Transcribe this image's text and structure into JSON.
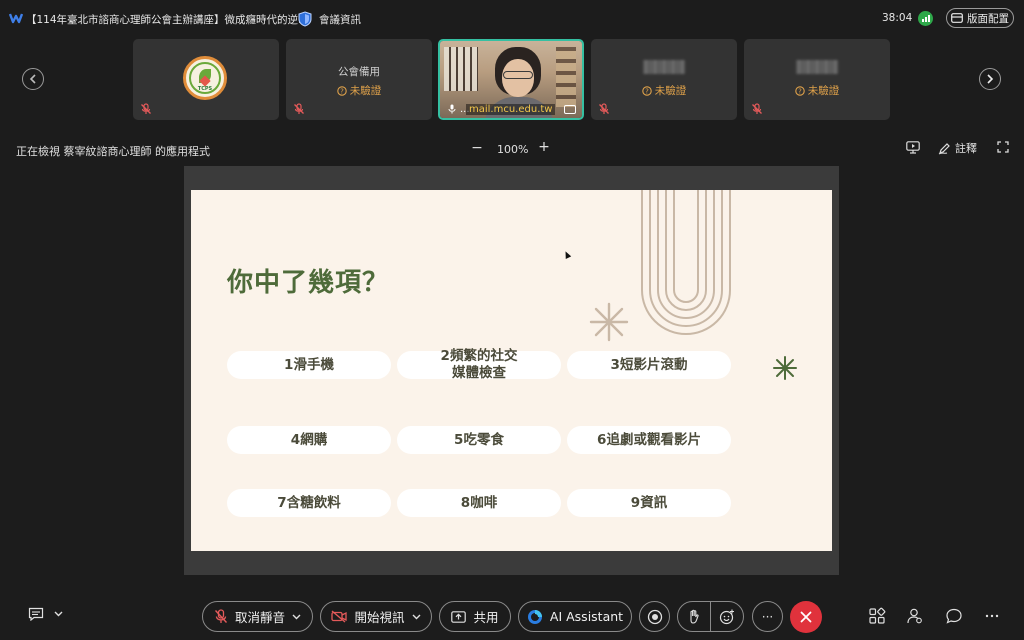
{
  "titlebar": {
    "meeting_title": "【114年臺北市諮商心理師公會主辦講座】微成癮時代的逆...",
    "info_label": "會議資訊",
    "timer": "38:04",
    "layout_label": "版面配置"
  },
  "participants": [
    {
      "name": "",
      "status": "",
      "type": "logo",
      "logo_text": "TCPS"
    },
    {
      "name": "公會備用",
      "status": "未驗證",
      "type": "name"
    },
    {
      "name": "",
      "status": "",
      "type": "video",
      "email": "mail.mcu.edu.tw",
      "menu": "..."
    },
    {
      "name": "",
      "status": "未驗證",
      "type": "blurred"
    },
    {
      "name": "",
      "status": "未驗證",
      "type": "blurred"
    }
  ],
  "share_bar": {
    "viewing_label": "正在檢視 蔡宰紋諮商心理師 的應用程式",
    "zoom_minus": "−",
    "zoom_value": "100%",
    "zoom_plus": "+",
    "annotate_label": "註釋"
  },
  "slide": {
    "title": "你中了幾項？",
    "items": [
      "1滑手機",
      "2頻繁的社交\n媒體檢查",
      "3短影片滾動",
      "4網購",
      "5吃零食",
      "6追劇或觀看影片",
      "7含糖飲料",
      "8咖啡",
      "9資訊"
    ],
    "colors": {
      "background": "#fbf3ea",
      "title": "#4e6b3a",
      "accent": "#4e6b3a",
      "decor": "#c9b8a6"
    }
  },
  "controls": {
    "mute_label": "取消靜音",
    "video_label": "開始視訊",
    "share_label": "共用",
    "ai_label": "AI Assistant",
    "more_label": "···"
  },
  "icons": {
    "app": "webex-icon",
    "info": "shield-icon",
    "signal": "signal-icon",
    "layout": "layout-icon",
    "mic_off": "mic-off-icon",
    "warning": "question-circle-icon"
  },
  "theme": {
    "end_call": "#e0323c",
    "active_border": "#35c0a2",
    "warning": "#e0a24a"
  }
}
